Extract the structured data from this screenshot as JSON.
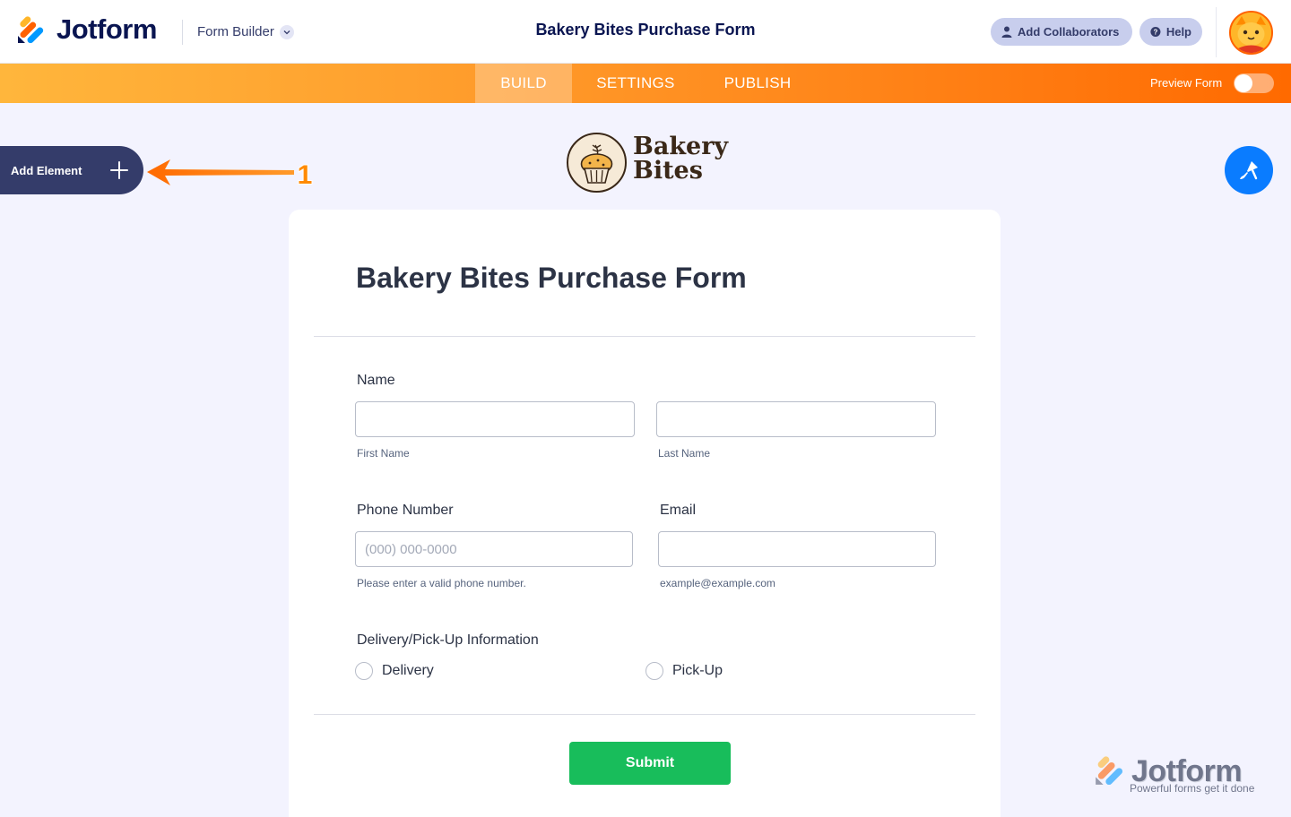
{
  "header": {
    "brand": "Jotform",
    "builder_menu": "Form Builder",
    "form_title": "Bakery Bites Purchase Form",
    "add_collaborators": "Add Collaborators",
    "help": "Help"
  },
  "nav": {
    "tabs": [
      {
        "label": "BUILD",
        "active": true
      },
      {
        "label": "SETTINGS",
        "active": false
      },
      {
        "label": "PUBLISH",
        "active": false
      }
    ],
    "preview_label": "Preview Form",
    "preview_on": false
  },
  "sidebar": {
    "add_element": "Add Element",
    "annotation_number": "1"
  },
  "brand_logo": {
    "line1": "Bakery",
    "line2": "Bites"
  },
  "form": {
    "title": "Bakery Bites Purchase Form",
    "name": {
      "label": "Name",
      "first_sub": "First Name",
      "last_sub": "Last Name",
      "first_value": "",
      "last_value": ""
    },
    "phone": {
      "label": "Phone Number",
      "placeholder": "(000) 000-0000",
      "sub": "Please enter a valid phone number.",
      "value": ""
    },
    "email": {
      "label": "Email",
      "sub": "example@example.com",
      "value": ""
    },
    "delivery": {
      "label": "Delivery/Pick-Up Information",
      "options": [
        "Delivery",
        "Pick-Up"
      ]
    },
    "submit": "Submit"
  },
  "watermark": {
    "brand": "Jotform",
    "tagline": "Powerful forms get it done"
  },
  "colors": {
    "brand_navy": "#0a1551",
    "orange_start": "#ffb63c",
    "orange_end": "#ff6a00",
    "submit_green": "#18bd5b",
    "designer_blue": "#0a7cff",
    "page_bg": "#f3f3fe"
  },
  "icons": {
    "logo": "jotform-logo-icon",
    "chevron": "chevron-down-icon",
    "collaborators": "user-icon",
    "help": "question-circle-icon",
    "add": "plus-icon",
    "designer": "paint-brush-icon",
    "annotation_arrow": "arrow-left-icon"
  }
}
